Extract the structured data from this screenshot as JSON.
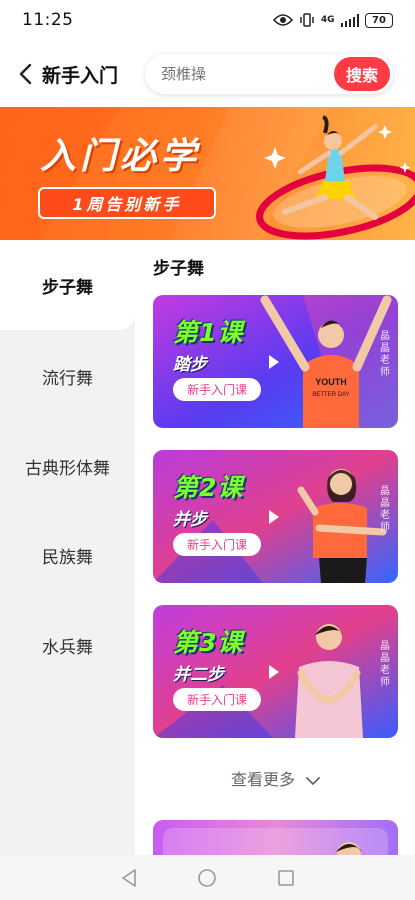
{
  "status_bar": {
    "time": "11:25",
    "network": "4G",
    "battery": "70"
  },
  "header": {
    "title": "新手入门"
  },
  "search": {
    "placeholder": "颈椎操",
    "value": "颈椎操",
    "button": "搜索"
  },
  "banner": {
    "title": "入门必学",
    "tagline": "1周告别新手"
  },
  "sidebar": {
    "items": [
      {
        "label": "步子舞",
        "active": true
      },
      {
        "label": "流行舞",
        "active": false
      },
      {
        "label": "古典形体舞",
        "active": false
      },
      {
        "label": "民族舞",
        "active": false
      },
      {
        "label": "水兵舞",
        "active": false
      }
    ]
  },
  "content": {
    "section_title": "步子舞",
    "courses": [
      {
        "lesson": "第1课",
        "step": "踏步",
        "badge": "新手入门课",
        "teacher": "晶晶老师",
        "shirt": "YOUTH BETTER DAY"
      },
      {
        "lesson": "第2课",
        "step": "并步",
        "badge": "新手入门课",
        "teacher": "晶晶老师"
      },
      {
        "lesson": "第3课",
        "step": "并二步",
        "badge": "新手入门课",
        "teacher": "晶晶老师"
      }
    ],
    "more": "查看更多"
  },
  "colors": {
    "accent": "#ff3b45",
    "banner": "#ff6a1f",
    "lesson_text": "#7cff2a",
    "badge_text": "#e8408a"
  }
}
